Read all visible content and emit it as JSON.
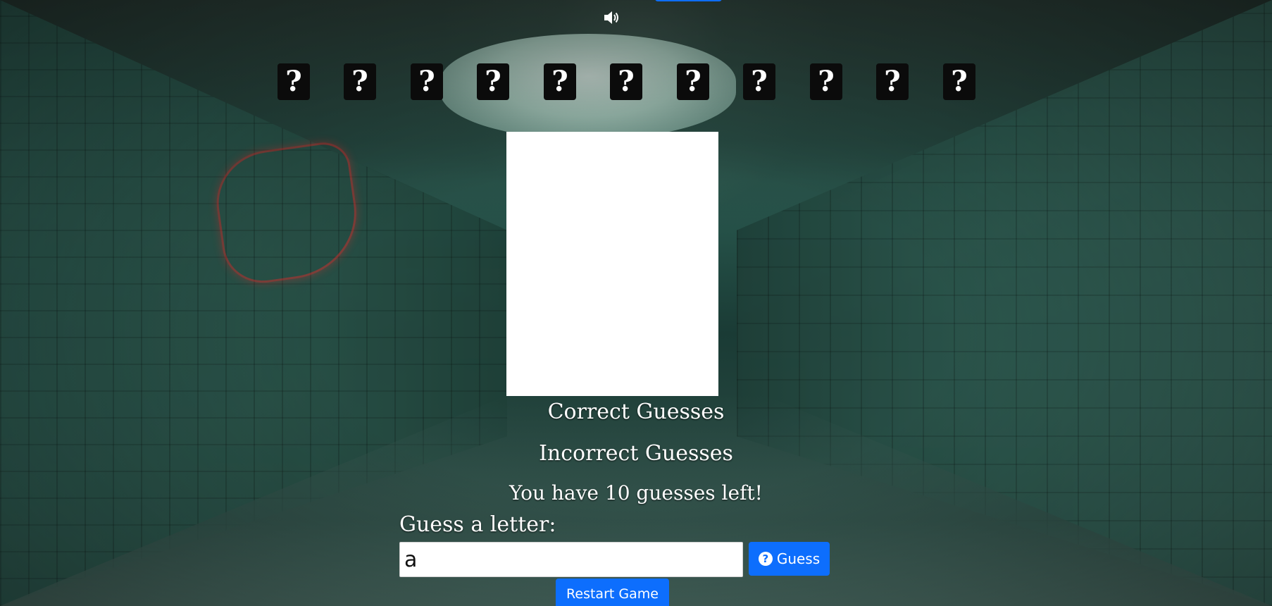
{
  "game": {
    "word_tiles": [
      "?",
      "?",
      "?",
      "?",
      "?",
      "?",
      "?",
      "?",
      "?",
      "?",
      "?"
    ],
    "correct_guesses_label": "Correct Guesses",
    "incorrect_guesses_label": "Incorrect Guesses",
    "guesses_left_text": "You have 10 guesses left!"
  },
  "form": {
    "guess_label": "Guess a letter:",
    "guess_value": "a",
    "guess_button_label": "Guess",
    "restart_button_label": "Restart Game"
  },
  "icons": {
    "sound": "speaker-icon",
    "guess": "question-circle-icon"
  },
  "colors": {
    "primary_button": "#0d6efd",
    "tile_background": "#0b0b0b"
  }
}
